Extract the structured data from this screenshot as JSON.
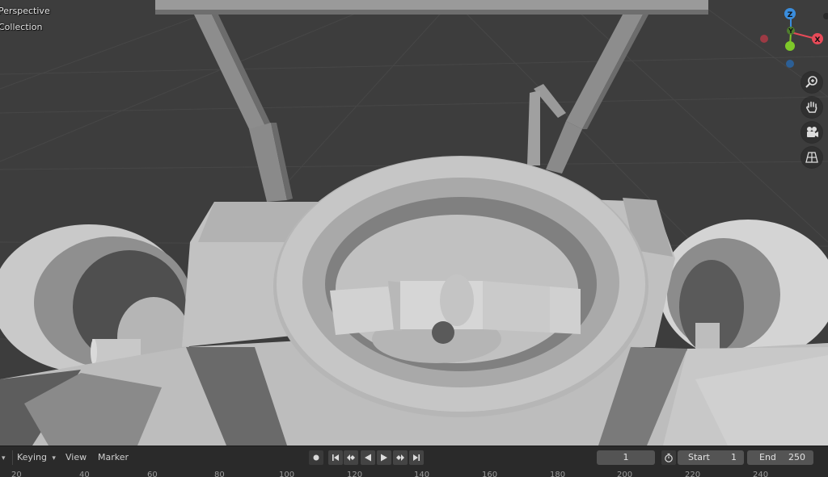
{
  "viewport": {
    "view_name": "Perspective",
    "collection_name": "Collection"
  },
  "gizmo": {
    "x_label": "X",
    "y_label": "Y",
    "z_label": "Z",
    "colors": {
      "x": "#e74a58",
      "y": "#7ec829",
      "z": "#3a8ddd"
    }
  },
  "nav_tools": [
    "zoom-icon",
    "pan-hand-icon",
    "camera-icon",
    "grid-ortho-icon"
  ],
  "timeline": {
    "dropdown_label": "",
    "keying_label": "Keying",
    "view_label": "View",
    "marker_label": "Marker",
    "current_frame": "1",
    "start_label": "Start",
    "start_value": "1",
    "end_label": "End",
    "end_value": "250",
    "ruler_ticks": [
      "20",
      "40",
      "60",
      "80",
      "100",
      "120",
      "140",
      "160",
      "180",
      "200",
      "220",
      "240"
    ]
  }
}
